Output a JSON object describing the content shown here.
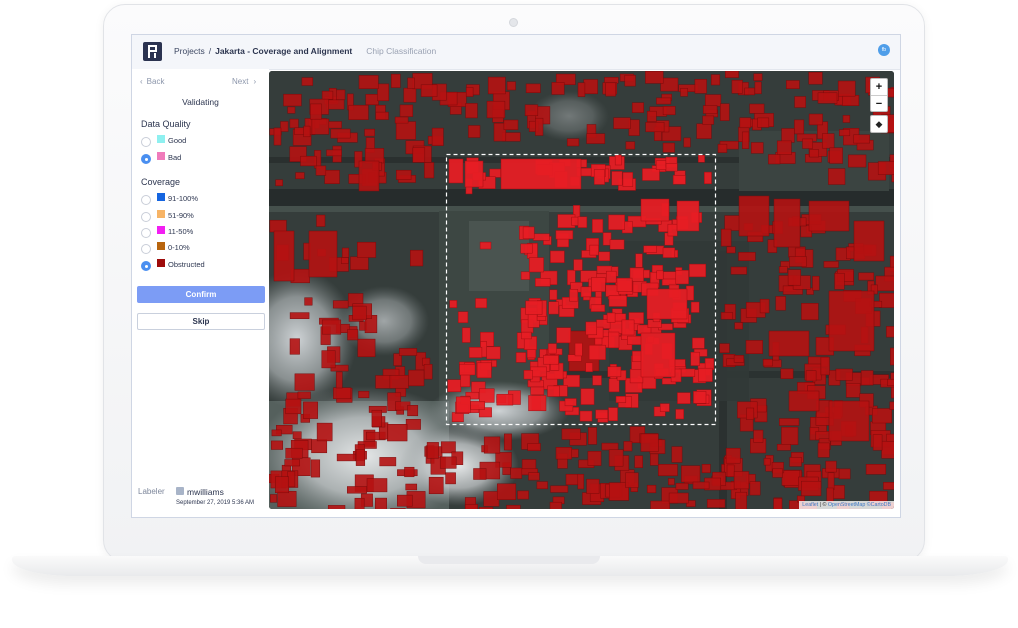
{
  "header": {
    "projects_label": "Projects",
    "separator": "/",
    "project_name": "Jakarta - Coverage and Alignment",
    "task_type": "Chip Classification",
    "avatar_initials": "fb"
  },
  "nav": {
    "back_label": "Back",
    "next_label": "Next",
    "back_icon": "chevron-left-icon",
    "next_icon": "chevron-right-icon"
  },
  "status": "Validating",
  "data_quality": {
    "title": "Data Quality",
    "options": [
      {
        "label": "Good",
        "color": "#8ff0f0",
        "selected": false
      },
      {
        "label": "Bad",
        "color": "#f07bbb",
        "selected": true
      }
    ]
  },
  "coverage": {
    "title": "Coverage",
    "options": [
      {
        "label": "91-100%",
        "color": "#1565e0",
        "selected": false
      },
      {
        "label": "51-90%",
        "color": "#f7b466",
        "selected": false
      },
      {
        "label": "11-50%",
        "color": "#f21ff2",
        "selected": false
      },
      {
        "label": "0-10%",
        "color": "#b8650e",
        "selected": false
      },
      {
        "label": "Obstructed",
        "color": "#9e0b0b",
        "selected": true
      }
    ]
  },
  "actions": {
    "confirm_label": "Confirm",
    "skip_label": "Skip"
  },
  "labeler": {
    "label": "Labeler",
    "user": "mwilliams",
    "timestamp": "September 27, 2019 5:36 AM"
  },
  "map": {
    "zoom_in": "+",
    "zoom_out": "−",
    "layers_icon": "layers-icon",
    "attribution": {
      "leaflet": "Leaflet",
      "sep": " | © ",
      "osm": "OpenStreetMap",
      "carto": " ©CartoDB"
    },
    "overlay_color": "#c81414",
    "chip_overlay_color": "#e81e24"
  }
}
